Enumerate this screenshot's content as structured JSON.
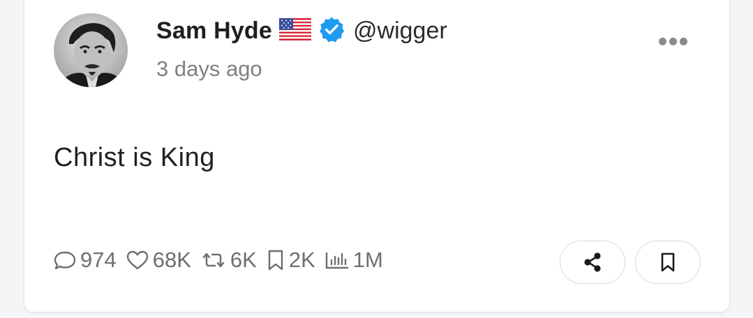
{
  "post": {
    "author_name": "Sam Hyde",
    "flag_icon": "us-flag-icon",
    "verified_icon": "verified-badge-icon",
    "handle": "@wigger",
    "timestamp": "3 days ago",
    "text": "Christ is King"
  },
  "stats": {
    "replies": "974",
    "likes": "68K",
    "reposts": "6K",
    "bookmarks": "2K",
    "views": "1M"
  },
  "actions": {
    "share_icon": "share-icon",
    "bookmark_icon": "bookmark-icon",
    "more_icon": "more-options-icon"
  },
  "colors": {
    "verified_blue": "#1d9bf0",
    "muted_text": "#808080",
    "card_bg": "#ffffff",
    "page_bg": "#f5f5f5"
  }
}
